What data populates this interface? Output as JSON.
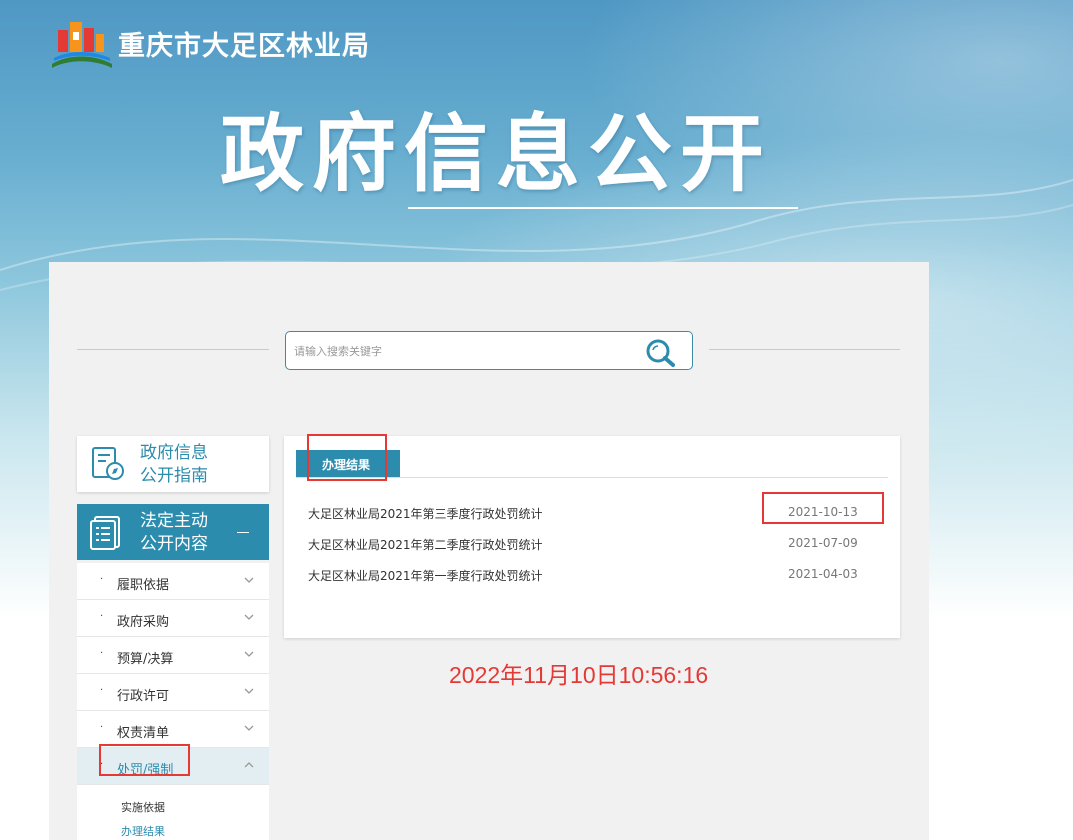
{
  "site": {
    "title": "重庆市大足区林业局"
  },
  "hero": {
    "title": "政府信息公开"
  },
  "search": {
    "placeholder": "请输入搜索关键字"
  },
  "sidebar": {
    "guide": {
      "line1": "政府信息",
      "line2": "公开指南"
    },
    "main": {
      "line1": "法定主动",
      "line2": "公开内容"
    },
    "items": [
      {
        "label": "履职依据"
      },
      {
        "label": "政府采购"
      },
      {
        "label": "预算/决算"
      },
      {
        "label": "行政许可"
      },
      {
        "label": "权责清单"
      },
      {
        "label": "处罚/强制"
      }
    ],
    "subitems": [
      {
        "label": "实施依据"
      },
      {
        "label": "办理结果"
      }
    ]
  },
  "content": {
    "tab": "办理结果",
    "rows": [
      {
        "title": "大足区林业局2021年第三季度行政处罚统计",
        "date": "2021-10-13"
      },
      {
        "title": "大足区林业局2021年第二季度行政处罚统计",
        "date": "2021-07-09"
      },
      {
        "title": "大足区林业局2021年第一季度行政处罚统计",
        "date": "2021-04-03"
      }
    ]
  },
  "timestamp": "2022年11月10日10:56:16",
  "colors": {
    "accent": "#2b8cae",
    "annotation": "#e53935"
  }
}
